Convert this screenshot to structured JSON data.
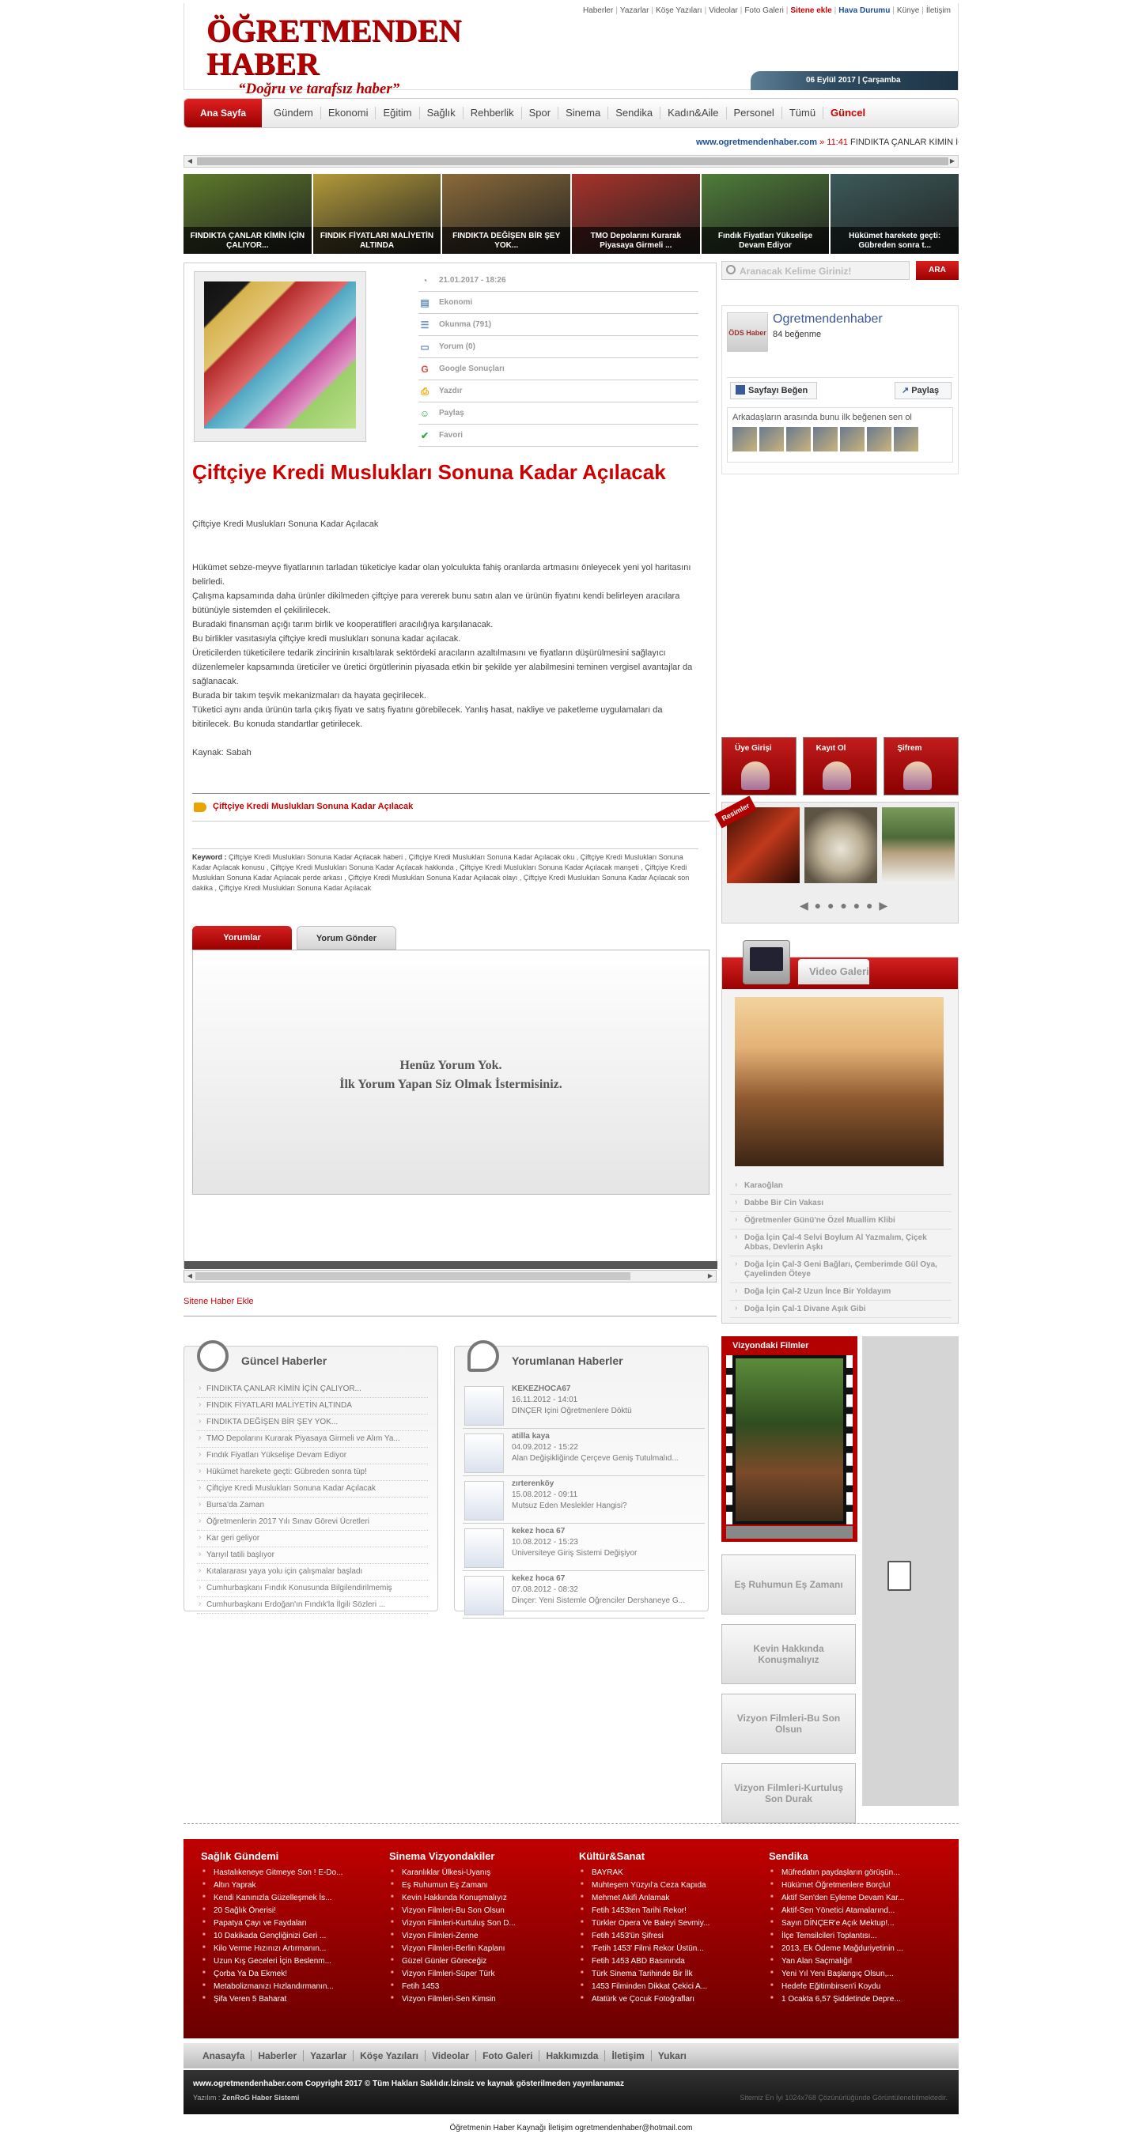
{
  "header": {
    "logo_title": "ÖĞRETMENDEN HABER",
    "logo_slogan": "“Doğru ve tarafsız haber”",
    "date": "06 Eylül 2017 | Çarşamba",
    "top_links": [
      "Haberler",
      "Yazarlar",
      "Köşe Yazıları",
      "Videolar",
      "Foto Galeri",
      "Sitene ekle",
      "Hava Durumu",
      "Künye",
      "İletişim"
    ]
  },
  "nav": {
    "home": "Ana Sayfa",
    "items": [
      "Gündem",
      "Ekonomi",
      "Eğitim",
      "Sağlık",
      "Rehberlik",
      "Spor",
      "Sinema",
      "Sendika",
      "Kadın&Aile",
      "Personel",
      "Tümü",
      "Güncel"
    ]
  },
  "ticker": {
    "site": "www.ogretmendenhaber.com",
    "sep": "»",
    "time": "11:41",
    "text": "FINDIKTA ÇANLAR KİMİN İÇİN ÇALIYOR..."
  },
  "headlines": [
    {
      "caption": "FINDIKTA ÇANLAR KİMİN İÇİN ÇALIYOR...",
      "color": "#5d7a2a"
    },
    {
      "caption": "FINDIK FİYATLARI MALİYETİN ALTINDA",
      "color": "#b39a3a"
    },
    {
      "caption": "FINDIKTA DEĞİŞEN BİR ŞEY YOK...",
      "color": "#8a6a3a"
    },
    {
      "caption": "TMO Depolarını Kurarak Piyasaya Girmeli ...",
      "color": "#a8322b"
    },
    {
      "caption": "Fındık Fiyatları Yükselişe Devam Ediyor",
      "color": "#4f7d3a"
    },
    {
      "caption": "Hükümet harekete geçti: Gübreden sonra t...",
      "color": "#3c5a5a"
    }
  ],
  "article": {
    "date": "21.01.2017 - 18:26",
    "meta": [
      "Ekonomi",
      "Okunma (791)",
      "Yorum (0)",
      "Google Sonuçları",
      "Yazdır",
      "Paylaş",
      "Favori"
    ],
    "title": "Çiftçiye Kredi Muslukları Sonuna Kadar Açılacak",
    "summary": "Çiftçiye Kredi Muslukları Sonuna Kadar Açılacak",
    "body": [
      "Hükümet sebze-meyve fiyatlarının tarladan tüketiciye kadar olan yolculukta fahiş oranlarda artmasını önleyecek yeni yol haritasını belirledi.",
      "Çalışma kapsamında daha ürünler dikilmeden çiftçiye para vererek bunu satın alan ve ürünün fiyatını kendi belirleyen aracılara bütünüyle sistemden el çekilirilecek.",
      "Buradaki finansman açığı tarım birlik ve kooperatifleri aracılığıya karşılanacak.",
      "Bu birlikler vasıtasıyla çiftçiye kredi muslukları sonuna kadar açılacak.",
      "Üreticilerden tüketicilere tedarik zincirinin kısaltılarak sektördeki aracıların azaltılmasını ve fiyatların düşürülmesini sağlayıcı düzenlemeler kapsamında üreticiler ve üretici örgütlerinin piyasada etkin bir şekilde yer alabilmesini teminen vergisel avantajlar da sağlanacak.",
      "Burada bir takım teşvik mekanizmaları da hayata geçirilecek.",
      "Tüketici aynı anda ürünün tarla çıkış fiyatı ve satış fiyatını görebilecek. Yanlış hasat, nakliye ve paketleme uygulamaları da bitirilecek. Bu konuda standartlar getirilecek.",
      "",
      "Kaynak: Sabah"
    ],
    "tag": "Çiftçiye Kredi Muslukları Sonuna Kadar Açılacak",
    "keywords_label": "Keyword :",
    "keywords": "Çiftçiye Kredi Muslukları Sonuna Kadar Açılacak haberi , Çiftçiye Kredi Muslukları Sonuna Kadar Açılacak oku , Çiftçiye Kredi Muslukları Sonuna Kadar Açılacak konusu , Çiftçiye Kredi Muslukları Sonuna Kadar Açılacak hakkında , Çiftçiye Kredi Muslukları Sonuna Kadar Açılacak manşeti , Çiftçiye Kredi Muslukları Sonuna Kadar Açılacak perde arkası , Çiftçiye Kredi Muslukları Sonuna Kadar Açılacak olayı , Çiftçiye Kredi Muslukları Sonuna Kadar Açılacak son dakika , Çiftçiye Kredi Muslukları Sonuna Kadar Açılacak",
    "tab_comments": "Yorumlar",
    "tab_send": "Yorum Gönder",
    "no_comments_1": "Henüz Yorum Yok.",
    "no_comments_2": "İlk Yorum Yapan Siz Olmak İstermisiniz."
  },
  "add_news": "Sitene Haber Ekle",
  "sidebar": {
    "search_placeholder": "Aranacak Kelime Giriniz!",
    "search_button": "ARA",
    "fb": {
      "name": "Ogretmendenhaber",
      "likes": "84 beğenme",
      "like_btn": "Sayfayı Beğen",
      "share_btn": "Paylaş",
      "friends_text": "Arkadaşların arasında bunu ilk beğenen sen ol",
      "logo": "ÖDS Haber"
    },
    "user_buttons": [
      "Üye Girişi",
      "Kayıt Ol",
      "Şifrem"
    ],
    "pictures_label": "Resimler",
    "video": {
      "title": "Video Galeri",
      "items": [
        "Karaoğlan",
        "Dabbe Bir Cin Vakası",
        "Öğretmenler Günü'ne Özel Muallim Klibi",
        "Doğa İçin Çal-4 Selvi Boylum Al Yazmalım, Çiçek Abbas, Devlerin Aşkı",
        "Doğa İçin Çal-3 Geni Bağları, Çemberimde Gül Oya, Çayelinden Öteye",
        "Doğa İçin Çal-2 Uzun İnce Bir Yoldayım",
        "Doğa İçin Çal-1 Divane Aşık Gibi"
      ]
    }
  },
  "guncel": {
    "title": "Güncel Haberler",
    "items": [
      "FINDIKTA ÇANLAR KİMİN İÇİN ÇALIYOR...",
      "FINDIK FİYATLARI MALİYETİN ALTINDA",
      "FINDIKTA DEĞİŞEN BİR ŞEY YOK...",
      "TMO Depolarını Kurarak Piyasaya Girmeli ve Alım Ya...",
      "Fındık Fiyatları Yükselişe Devam Ediyor",
      "Hükümet harekete geçti: Gübreden sonra tüp!",
      "Çiftçiye Kredi Muslukları Sonuna Kadar Açılacak",
      "Bursa'da Zaman",
      "Öğretmenlerin 2017 Yılı Sınav Görevi Ücretleri",
      "Kar geri geliyor",
      "Yarıyıl tatili başlıyor",
      "Kıtalararası yaya yolu için çalışmalar başladı",
      "Cumhurbaşkanı Fındık Konusunda Bilgilendirilmemiş",
      "Cumhurbaşkanı Erdoğan'ın Fındık'la İlgili Sözleri ..."
    ]
  },
  "yorumlanan": {
    "title": "Yorumlanan Haberler",
    "items": [
      {
        "name": "KEKEZHOCA67",
        "date": "16.11.2012 - 14:01",
        "text": "DİNÇER İçini Öğretmenlere Döktü"
      },
      {
        "name": "atilla kaya",
        "date": "04.09.2012 - 15:22",
        "text": "Alan Değişikliğinde Çerçeve Geniş Tutulmalıd..."
      },
      {
        "name": "zırterenköy",
        "date": "15.08.2012 - 09:11",
        "text": "Mutsuz Eden Meslekler Hangisi?"
      },
      {
        "name": "kekez hoca 67",
        "date": "10.08.2012 - 15:23",
        "text": "Üniversiteye Giriş Sistemi Değişiyor"
      },
      {
        "name": "kekez hoca 67",
        "date": "07.08.2012 - 08:32",
        "text": "Dinçer: Yeni Sistemle Öğrenciler Dershaneye G..."
      }
    ]
  },
  "vizyon": {
    "title": "Vizyondaki Filmler"
  },
  "side_buttons": [
    "Eş Ruhumun Eş Zamanı",
    "Kevin Hakkında Konuşmalıyız",
    "Vizyon Filmleri-Bu Son Olsun",
    "Vizyon Filmleri-Kurtuluş Son Durak"
  ],
  "footer": {
    "cols": [
      {
        "title": "Sağlık Gündemi",
        "items": [
          "Hastalıkeneye Gitmeye Son ! E-Do...",
          "Altın Yaprak",
          "Kendi Kanınızla Güzelleşmek İs...",
          "20 Sağlık Önerisi!",
          "Papatya Çayı ve Faydaları",
          "10 Dakikada Gençliğinizi Geri ...",
          "Kilo Verme Hızınızı Artırmanın...",
          "Uzun Kış Geceleri İçin Beslenm...",
          "Çorba Ya Da Ekmek!",
          "Metabolizmanızı Hızlandırmanın...",
          "Şifa Veren 5 Baharat"
        ]
      },
      {
        "title": "Sinema Vizyondakiler",
        "items": [
          "Karanlıklar Ülkesi-Uyanış",
          "Eş Ruhumun Eş Zamanı",
          "Kevin Hakkında Konuşmalıyız",
          "Vizyon Filmleri-Bu Son Olsun",
          "Vizyon Filmleri-Kurtuluş Son D...",
          "Vizyon Filmleri-Zenne",
          "Vizyon Filmleri-Berlin Kaplanı",
          "Güzel Günler Göreceğiz",
          "Vizyon Filmleri-Süper Türk",
          "Fetih 1453",
          "Vizyon Filmleri-Sen Kimsin"
        ]
      },
      {
        "title": "Kültür&Sanat",
        "items": [
          "BAYRAK",
          "Muhteşem Yüzyıl'a Ceza Kapıda",
          "Mehmet Akifi Anlamak",
          "Fetih 1453ten Tarihi Rekor!",
          "Türkler Opera Ve Baleyi Sevmiy...",
          "Fetih 1453'ün Şifresi",
          "'Fetih 1453' Filmi Rekor Üstün...",
          "Fetih 1453 ABD Basınında",
          "Türk Sinema Tarihinde Bir İlk",
          "1453 Filminden Dikkat Çekici A...",
          "Atatürk ve Çocuk Fotoğrafları"
        ]
      },
      {
        "title": "Sendika",
        "items": [
          "Müfredatın paydaşların görüşün...",
          "Hükümet Öğretmenlere Borçlu!",
          "Aktif Sen'den Eyleme Devam Kar...",
          "Aktif-Sen Yönetici Atamalarınd...",
          "Sayın DİNÇER'e Açık Mektup!...",
          "İlçe Temsilcileri Toplantısı...",
          "2013, Ek Ödeme Mağduriyetinin ...",
          "Yan Alan Saçmalığı!",
          "Yeni Yıl Yeni Başlangıç Olsun,...",
          "Hedefe Eğitimbirsen'i Koydu",
          "1 Ocakta 6,57 Şiddetinde Depre..."
        ]
      }
    ],
    "nav": [
      "Anasayfa",
      "Haberler",
      "Yazarlar",
      "Köşe Yazıları",
      "Videolar",
      "Foto Galeri",
      "Hakkımızda",
      "İletişim",
      "Yukarı"
    ],
    "copyright": "www.ogretmendenhaber.com Copyright 2017 © Tüm Hakları Saklıdır.İzinsiz ve kaynak gösterilmeden yayınlanamaz",
    "software_label": "Yazılım :",
    "software": "ZenRoG Haber Sistemi",
    "resolution": "Sitemiz En İyi 1024x768 Çözünürlüğünde Görüntülenebilmektedir.",
    "contact": "Öğretmenin Haber Kaynağı İletişim ogretmendenhaber@hotmail.com"
  }
}
